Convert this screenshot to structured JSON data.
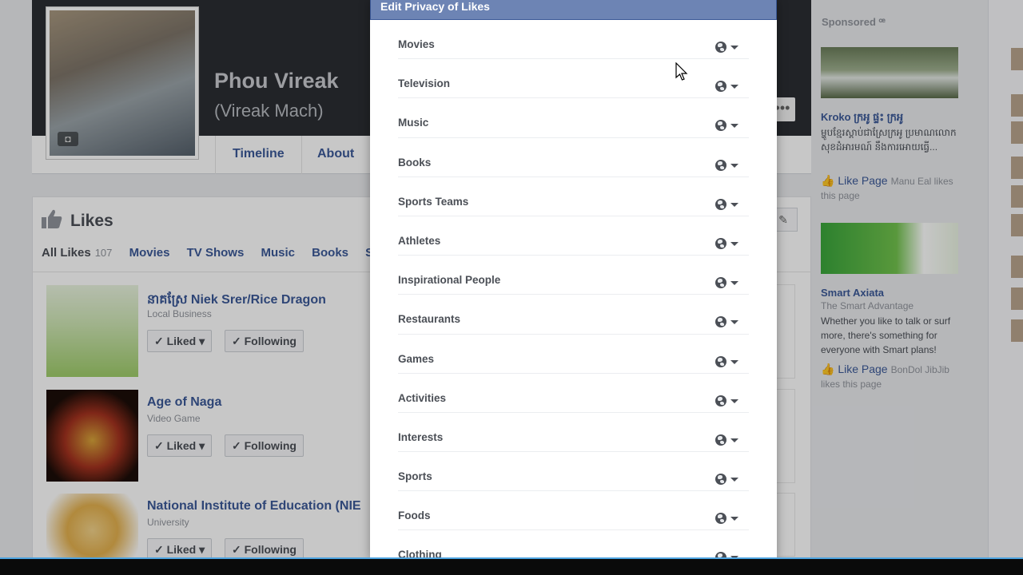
{
  "profile": {
    "name": "Phou Vireak",
    "alt_name": "(Vireak Mach)",
    "camera_glyph": "◘",
    "more_glyph": "•••",
    "tabs": [
      "Timeline",
      "About"
    ]
  },
  "likes": {
    "heading": "Likes",
    "edit_glyph": "✎",
    "filters": {
      "all_label": "All Likes",
      "all_count": "107",
      "items": [
        "Movies",
        "TV Shows",
        "Music",
        "Books",
        "Sp"
      ]
    },
    "items": [
      {
        "title": "នាគស្រែ Niek Srer/Rice Dragon",
        "category": "Local Business",
        "liked_label": "✓ Liked ▾",
        "following_label": "✓ Following"
      },
      {
        "title": "Age of Naga",
        "category": "Video Game",
        "liked_label": "✓ Liked ▾",
        "following_label": "✓ Following"
      },
      {
        "title": "National Institute of Education (NIE",
        "category": "University",
        "liked_label": "✓ Liked ▾",
        "following_label": "✓ Following"
      }
    ]
  },
  "sidebar": {
    "heading": "Sponsored ꟹ",
    "ads": [
      {
        "title": "Kroko ក្រអូ ផ្ទះ ក្រអូ",
        "body": "ម្ហូបខ្មែរស្ដាប់ជាស្រែក្រអូ ប្រមាណលោកសុខដំអារមណ៍ នឹងការអោយធ្វើ...",
        "like_label": "Like Page",
        "social_prefix": "Manu Eal likes",
        "social_suffix": "this page"
      },
      {
        "title": "Smart Axiata",
        "subtitle": "The Smart Advantage",
        "body": "Whether you like to talk or surf more, there's something for everyone with Smart plans!",
        "like_label": "Like Page",
        "social_prefix": "BonDol JibJib",
        "social_suffix": "likes this page"
      }
    ]
  },
  "modal": {
    "title": "Edit Privacy of Likes",
    "audience_icon": "globe-icon",
    "categories": [
      "Movies",
      "Television",
      "Music",
      "Books",
      "Sports Teams",
      "Athletes",
      "Inspirational People",
      "Restaurants",
      "Games",
      "Activities",
      "Interests",
      "Sports",
      "Foods",
      "Clothing"
    ]
  },
  "colors": {
    "modal_header": "#6d84b4",
    "link_blue": "#3b5998",
    "taskbar_accent": "#4ca3e0"
  }
}
